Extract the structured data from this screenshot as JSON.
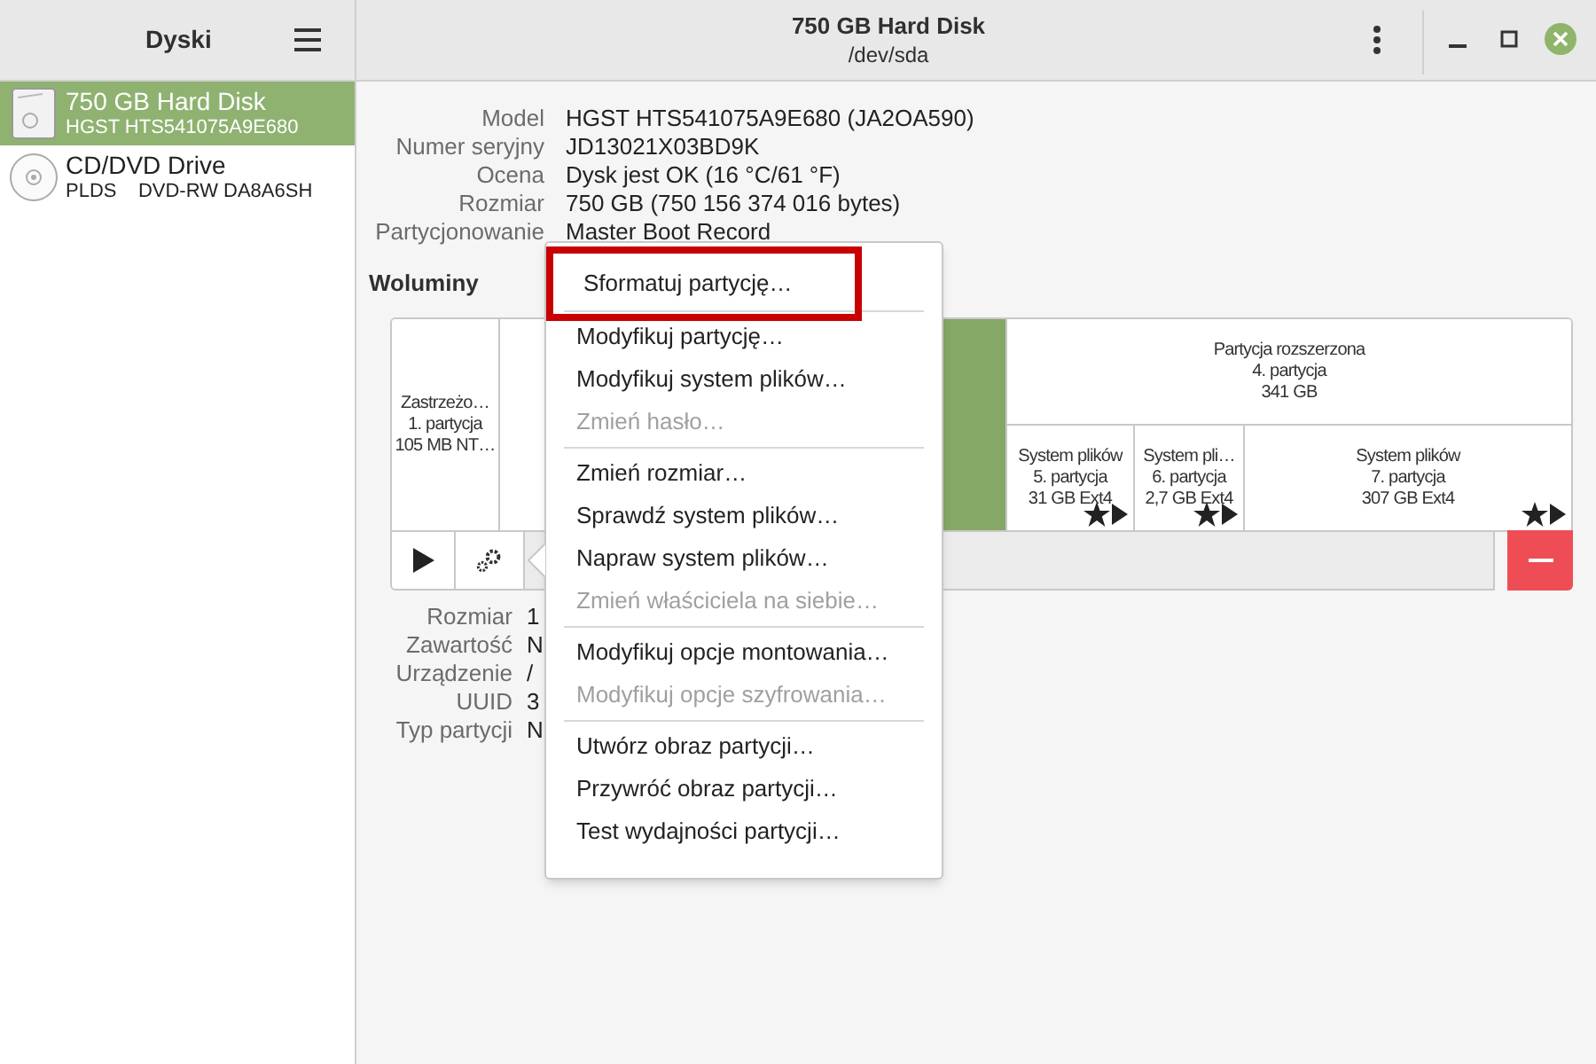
{
  "sidebar": {
    "title": "Dyski",
    "items": [
      {
        "kind": "hdd",
        "name": "750 GB Hard Disk",
        "detail": "HGST HTS541075A9E680",
        "selected": true
      },
      {
        "kind": "optical",
        "name": "CD/DVD Drive",
        "detail": "PLDS    DVD-RW DA8A6SH",
        "selected": false
      }
    ]
  },
  "header": {
    "title": "750 GB Hard Disk",
    "subtitle": "/dev/sda"
  },
  "drive_info": [
    {
      "label": "Model",
      "value": "HGST HTS541075A9E680 (JA2OA590)"
    },
    {
      "label": "Numer seryjny",
      "value": "JD13021X03BD9K"
    },
    {
      "label": "Ocena",
      "value": "Dysk jest OK (16 °C/61 °F)"
    },
    {
      "label": "Rozmiar",
      "value": "750 GB (750 156 374 016 bytes)"
    },
    {
      "label": "Partycjonowanie",
      "value": "Master Boot Record"
    }
  ],
  "volumes_heading": "Woluminy",
  "partitions": [
    {
      "lines": [
        "Zastrzeżo…",
        "1. partycja",
        "105 MB NT…"
      ],
      "selected": false
    },
    {
      "selected": true
    },
    {
      "lines": [
        "Partycja rozszerzona",
        "4. partycja",
        "341 GB"
      ],
      "selected": false,
      "children": [
        {
          "lines": [
            "System plików",
            "5. partycja",
            "31 GB Ext4"
          ],
          "selected": false,
          "mounted": true
        },
        {
          "lines": [
            "System pli…",
            "6. partycja",
            "2,7 GB Ext4"
          ],
          "selected": false,
          "mounted": true
        },
        {
          "lines": [
            "System plików",
            "7. partycja",
            "307 GB Ext4"
          ],
          "selected": false,
          "mounted": true
        }
      ]
    }
  ],
  "volume_info": [
    {
      "label": "Rozmiar",
      "value": "1"
    },
    {
      "label": "Zawartość",
      "value": "N"
    },
    {
      "label": "Urządzenie",
      "value": "/"
    },
    {
      "label": "UUID",
      "value": "3"
    },
    {
      "label": "Typ partycji",
      "value": "N"
    }
  ],
  "menu": [
    [
      {
        "label": "Sformatuj partycję…",
        "disabled": false,
        "highlighted": true
      }
    ],
    [
      {
        "label": "Modyfikuj partycję…",
        "disabled": false,
        "highlighted": false
      },
      {
        "label": "Modyfikuj system plików…",
        "disabled": false,
        "highlighted": false
      },
      {
        "label": "Zmień hasło…",
        "disabled": true,
        "highlighted": false
      }
    ],
    [
      {
        "label": "Zmień rozmiar…",
        "disabled": false,
        "highlighted": false
      },
      {
        "label": "Sprawdź system plików…",
        "disabled": false,
        "highlighted": false
      },
      {
        "label": "Napraw system plików…",
        "disabled": false,
        "highlighted": false
      },
      {
        "label": "Zmień właściciela na siebie…",
        "disabled": true,
        "highlighted": false
      }
    ],
    [
      {
        "label": "Modyfikuj opcje montowania…",
        "disabled": false,
        "highlighted": false
      },
      {
        "label": "Modyfikuj opcje szyfrowania…",
        "disabled": true,
        "highlighted": false
      }
    ],
    [
      {
        "label": "Utwórz obraz partycji…",
        "disabled": false,
        "highlighted": false
      },
      {
        "label": "Przywróć obraz partycji…",
        "disabled": false,
        "highlighted": false
      },
      {
        "label": "Test wydajności partycji…",
        "disabled": false,
        "highlighted": false
      }
    ]
  ]
}
